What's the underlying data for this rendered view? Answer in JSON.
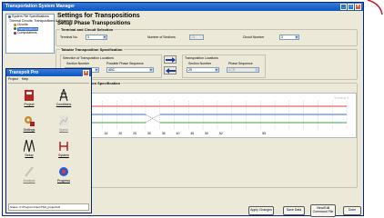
{
  "window": {
    "title": "Transportation System Manager"
  },
  "tree": {
    "items": [
      {
        "label": "System File Specifications",
        "color": "#3a6ea5"
      },
      {
        "label": "Thermal Circuits, Transpositions & Segments",
        "color": "#3a6ea5"
      },
      {
        "label": "Circuits",
        "color": "#d08a2a"
      },
      {
        "label": "Transpositions",
        "color": "#2a8a2a",
        "selected": true
      },
      {
        "label": "Computations",
        "color": "#7a3aa5"
      }
    ]
  },
  "page": {
    "title": "Settings for Transpositions",
    "subtitle": "Setup Phase Transpositions"
  },
  "terminal": {
    "group_title": "Terminal and Circuit Selection",
    "terminal_label": "Terminal No.",
    "terminal_value": "3",
    "sections_label": "Number of Sections",
    "sections_value": "13",
    "circuit_label": "Circuit Number",
    "circuit_value": "3"
  },
  "tabular": {
    "group_title": "Tabular Transposition Specification",
    "selection_title": "Selection of Transposition Locations",
    "section_col": "Section Number",
    "phase_col": "Possible Phase Sequence",
    "section_value": "",
    "phase_value": "ABC",
    "locations_title": "Transposition Locations",
    "loc_section_col": "Section Number",
    "loc_phase_col": "Phase Sequence",
    "loc_section_value": "25",
    "loc_phase_value": "ACB"
  },
  "visual": {
    "group_title": "Visual Transposition Specification",
    "left_label": "Circuit",
    "right_label": "Terminal 3",
    "phases": [
      "1",
      "2",
      "3"
    ],
    "phase_colors": [
      "#d94040",
      "#3a6ed9",
      "#40a040"
    ],
    "sections": [
      "1",
      "8",
      "16",
      "20",
      "25",
      "30",
      "35",
      "40",
      "45",
      "50",
      "52",
      "",
      "",
      "55",
      "",
      "",
      "",
      "",
      ""
    ]
  },
  "buttons": {
    "apply": "Apply Changes",
    "save": "Save Data",
    "view": "View/Edit Command File",
    "done": "Done"
  },
  "pro": {
    "title": "Transpolt Pro",
    "menu": [
      "Project",
      "Help"
    ],
    "items": [
      {
        "label": "Project",
        "icon": "project-book-icon",
        "enabled": true
      },
      {
        "label": "Conditions",
        "icon": "tower-icon",
        "enabled": true
      },
      {
        "label": "Settings",
        "icon": "gears-icon",
        "enabled": true
      },
      {
        "label": "Specs",
        "icon": "chart-icon",
        "enabled": false
      },
      {
        "label": "Setup",
        "icon": "towers-icon",
        "enabled": true
      },
      {
        "label": "System",
        "icon": "network-icon",
        "enabled": true
      },
      {
        "label": "Analysis",
        "icon": "pencil-icon",
        "enabled": false
      },
      {
        "label": "Progress",
        "icon": "globe-icon",
        "enabled": true
      }
    ],
    "status": "Status: C:\\Program Files\\TSM_project\\C0"
  }
}
